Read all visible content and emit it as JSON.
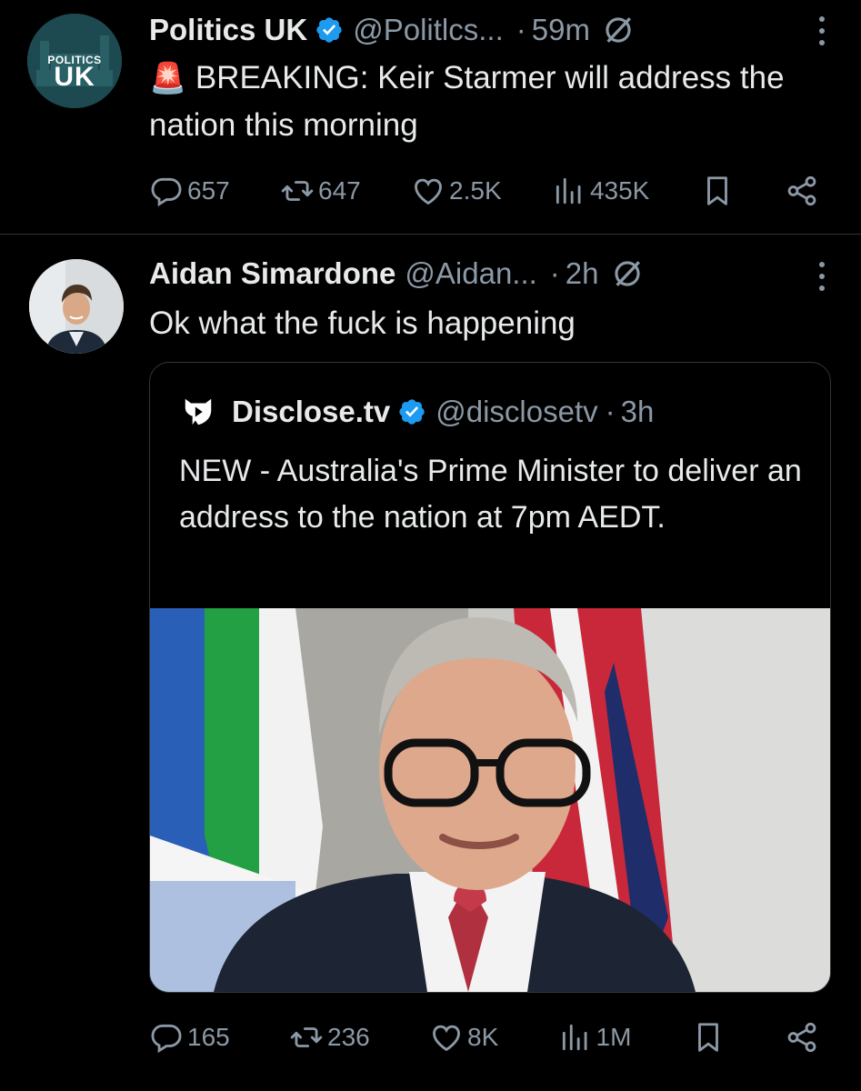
{
  "tweet1": {
    "avatar_text_top": "POLITICS",
    "avatar_text_bottom": "UK",
    "name": "Politics UK",
    "handle": "@Politlcs...",
    "dot": "·",
    "time": "59m",
    "emoji": "🚨",
    "text": "BREAKING: Keir Starmer will address the nation this morning",
    "replies": "657",
    "reposts": "647",
    "likes": "2.5K",
    "views": "435K"
  },
  "tweet2": {
    "name": "Aidan Simardone",
    "handle": "@Aidan...",
    "dot": "·",
    "time": "2h",
    "text": "Ok what the fuck is happening",
    "replies": "165",
    "reposts": "236",
    "likes": "8K",
    "views": "1M",
    "quote": {
      "name": "Disclose.tv",
      "handle": "@disclosetv",
      "dot": "·",
      "time": "3h",
      "text": "NEW - Australia's Prime Minister to deliver an address to the nation at 7pm AEDT."
    }
  },
  "colors": {
    "background": "#000000",
    "text_primary": "#e7e9ea",
    "text_secondary": "#8b98a5",
    "verified_blue": "#1d9bf0",
    "divider": "#2f3336"
  },
  "icons": [
    "verified-badge-icon",
    "grok-icon",
    "more-icon",
    "reply-icon",
    "repost-icon",
    "like-icon",
    "views-icon",
    "bookmark-icon",
    "share-icon"
  ]
}
